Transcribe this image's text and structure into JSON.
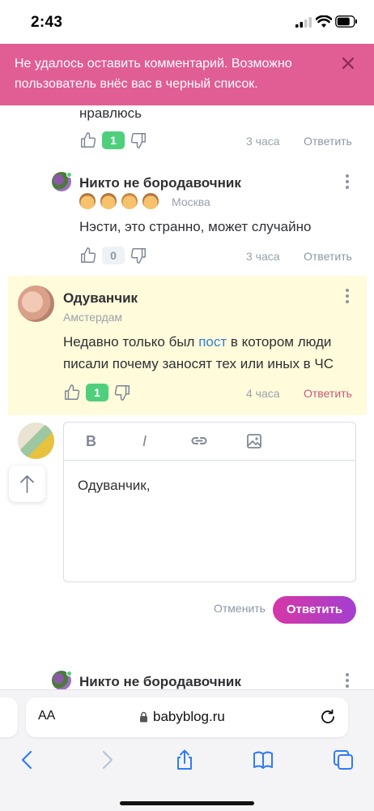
{
  "status_bar": {
    "time": "2:43"
  },
  "banner": {
    "message": "Не удалось оставить комментарий. Возможно пользователь внёс вас в черный список."
  },
  "fragment": {
    "text": "нравлюсь",
    "likes": "1",
    "time": "3 часа",
    "reply": "Ответить"
  },
  "comments": [
    {
      "author": "Никто не бородавочник",
      "city": "Москва",
      "text": "Нэсти, это странно, может случайно",
      "likes": "0",
      "time": "3 часа",
      "reply": "Ответить"
    },
    {
      "author": "Одуванчик",
      "city": "Амстердам",
      "text_before": "Недавно только был ",
      "text_link": "пост",
      "text_after": " в котором люди писали почему заносят тех или иных в ЧС",
      "likes": "1",
      "time": "4 часа",
      "reply": "Ответить"
    }
  ],
  "editor": {
    "value": "Одуванчик,",
    "tools": [
      "B",
      "I",
      "link-icon",
      "image-icon"
    ],
    "cancel": "Отменить",
    "submit": "Ответить"
  },
  "next_comment": {
    "author": "Никто не бородавочник"
  },
  "safari": {
    "aa_label": "AA",
    "url": "babyblog.ru"
  },
  "colors": {
    "banner": "#e05e93",
    "highlight": "#fffbdb",
    "like_green": "#4fcf7c",
    "accent_gradient_start": "#d637a6",
    "accent_gradient_end": "#a43fd0"
  }
}
